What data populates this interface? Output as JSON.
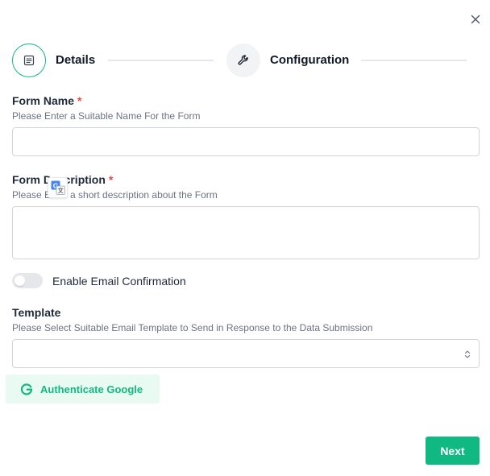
{
  "icons": {
    "close": "close-icon",
    "details_step": "document-icon",
    "configuration_step": "wrench-icon",
    "translate": "google-translate-icon",
    "select_chevron": "chevron-up-down-icon",
    "google": "google-g-icon"
  },
  "colors": {
    "accent": "#10b981",
    "accent_light": "#e9faf3",
    "required": "#ef4444"
  },
  "stepper": {
    "steps": [
      {
        "label": "Details",
        "state": "active"
      },
      {
        "label": "Configuration",
        "state": "inactive"
      }
    ]
  },
  "form_name": {
    "label": "Form Name",
    "required_mark": "*",
    "help": "Please Enter a Suitable Name For the Form",
    "value": ""
  },
  "form_description": {
    "label": "Form Description",
    "required_mark": "*",
    "help": "Please Enter a short description about the Form",
    "value": ""
  },
  "email_confirmation": {
    "label": "Enable Email Confirmation",
    "enabled": false
  },
  "template": {
    "label": "Template",
    "help": "Please Select Suitable Email Template to Send in Response to the Data Submission",
    "selected": ""
  },
  "actions": {
    "authenticate_google": "Authenticate Google",
    "next": "Next"
  }
}
